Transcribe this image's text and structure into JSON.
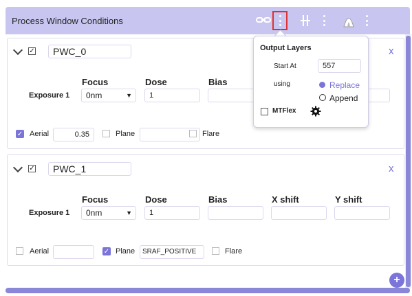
{
  "header": {
    "title": "Process Window Conditions"
  },
  "icons": {
    "link": "link-icon",
    "menu": "kebab-icon",
    "split": "split-icon",
    "mask": "mask-icon",
    "gear": "gear-icon",
    "plus": "plus-icon"
  },
  "colors": {
    "accent": "#7b74d9",
    "header_bg": "#c8c6f0",
    "highlight": "#e03030"
  },
  "columns": {
    "focus": "Focus",
    "dose": "Dose",
    "bias": "Bias",
    "xshift": "X shift",
    "yshift": "Y shift"
  },
  "cards": [
    {
      "name": "PWC_0",
      "checked": "✓",
      "close": "x",
      "exposure_label": "Exposure 1",
      "focus": "0nm",
      "dose": "1",
      "bias": "",
      "xshift": "",
      "yshift": "",
      "aerial_label": "Aerial",
      "aerial_value": "0.35",
      "plane_label": "Plane",
      "plane_value": "",
      "flare_label": "Flare"
    },
    {
      "name": "PWC_1",
      "checked": "✓",
      "close": "x",
      "exposure_label": "Exposure 1",
      "focus": "0nm",
      "dose": "1",
      "bias": "",
      "xshift": "",
      "yshift": "",
      "aerial_label": "Aerial",
      "aerial_value": "",
      "plane_label": "Plane",
      "plane_value": "SRAF_POSITIVE",
      "flare_label": "Flare"
    }
  ],
  "popover": {
    "title": "Output Layers",
    "start_at_label": "Start At",
    "start_at_value": "557",
    "using_label": "using",
    "replace_label": "Replace",
    "append_label": "Append",
    "mtflex_label": "MTFlex"
  },
  "add_button": "+"
}
